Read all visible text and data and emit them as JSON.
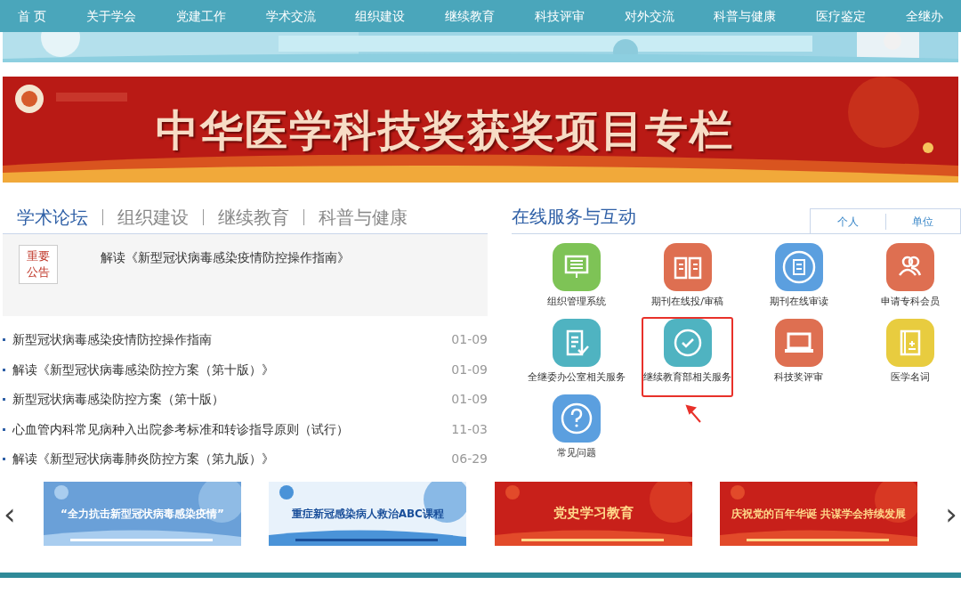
{
  "nav": {
    "items": [
      "首 页",
      "关于学会",
      "党建工作",
      "学术交流",
      "组织建设",
      "继续教育",
      "科技评审",
      "对外交流",
      "科普与健康",
      "医疗鉴定",
      "全继办"
    ]
  },
  "feature_banner": {
    "title": "中华医学科技奖获奖项目专栏"
  },
  "news": {
    "tabs": [
      {
        "label": "学术论坛",
        "selected": true
      },
      {
        "label": "组织建设",
        "selected": false
      },
      {
        "label": "继续教育",
        "selected": false
      },
      {
        "label": "科普与健康",
        "selected": false
      }
    ],
    "notice": {
      "badge": "重要公告",
      "headline": "解读《新型冠状病毒感染疫情防控操作指南》"
    },
    "items": [
      {
        "title": "新型冠状病毒感染疫情防控操作指南",
        "date": "01-09"
      },
      {
        "title": "解读《新型冠状病毒感染防控方案（第十版）》",
        "date": "01-09"
      },
      {
        "title": "新型冠状病毒感染防控方案（第十版）",
        "date": "01-09"
      },
      {
        "title": "心血管内科常见病种入出院参考标准和转诊指导原则（试行）",
        "date": "11-03"
      },
      {
        "title": "解读《新型冠状病毒肺炎防控方案（第九版）》",
        "date": "06-29"
      }
    ]
  },
  "services": {
    "title": "在线服务与互动",
    "tabs": [
      "个人",
      "单位"
    ],
    "items": [
      {
        "label": "组织管理系统",
        "color": "#7ec356",
        "highlighted": false
      },
      {
        "label": "期刊在线投/审稿",
        "color": "#de6f51",
        "highlighted": false
      },
      {
        "label": "期刊在线审读",
        "color": "#5b9fdf",
        "highlighted": false
      },
      {
        "label": "申请专科会员",
        "color": "#de6f51",
        "highlighted": false
      },
      {
        "label": "全继委办公室相关服务",
        "color": "#4fb3c1",
        "highlighted": false
      },
      {
        "label": "继续教育部相关服务",
        "color": "#4fb3c1",
        "highlighted": true
      },
      {
        "label": "科技奖评审",
        "color": "#de6f51",
        "highlighted": false
      },
      {
        "label": "医学名词",
        "color": "#e8cc3f",
        "highlighted": false
      },
      {
        "label": "常见问题",
        "color": "#5b9fdf",
        "highlighted": false
      }
    ]
  },
  "carousel": {
    "prev": "‹",
    "next": "›",
    "banners": [
      {
        "text": "“全力抗击新型冠状病毒感染疫情”",
        "kind": "blue"
      },
      {
        "text": "重症新冠感染病人救治ABC课程",
        "kind": "light"
      },
      {
        "text": "党史学习教育",
        "kind": "red"
      },
      {
        "text": "庆祝党的百年华诞  共谋学会持续发展",
        "kind": "red"
      }
    ]
  }
}
